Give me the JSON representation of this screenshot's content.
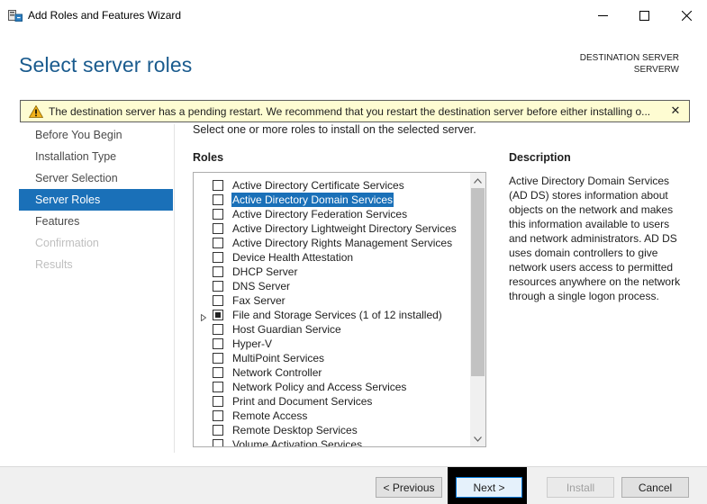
{
  "window": {
    "title": "Add Roles and Features Wizard",
    "minimize_icon": "minimize-icon",
    "maximize_icon": "maximize-icon",
    "close_icon": "close-icon"
  },
  "header": {
    "page_title": "Select server roles",
    "destination_label": "DESTINATION SERVER",
    "destination_value": "SERVERW"
  },
  "warning": {
    "text": "The destination server has a pending restart. We recommend that you restart the destination server before either installing o...",
    "icon": "warning-icon",
    "close_glyph": "✕"
  },
  "nav": {
    "items": [
      {
        "label": "Before You Begin",
        "state": "normal"
      },
      {
        "label": "Installation Type",
        "state": "normal"
      },
      {
        "label": "Server Selection",
        "state": "normal"
      },
      {
        "label": "Server Roles",
        "state": "active"
      },
      {
        "label": "Features",
        "state": "normal"
      },
      {
        "label": "Confirmation",
        "state": "disabled"
      },
      {
        "label": "Results",
        "state": "disabled"
      }
    ]
  },
  "main": {
    "instruction": "Select one or more roles to install on the selected server.",
    "roles_heading": "Roles",
    "description_heading": "Description",
    "description_text": "Active Directory Domain Services (AD DS) stores information about objects on the network and makes this information available to users and network administrators. AD DS uses domain controllers to give network users access to permitted resources anywhere on the network through a single logon process.",
    "roles": [
      {
        "label": "Active Directory Certificate Services",
        "checked": false
      },
      {
        "label": "Active Directory Domain Services",
        "checked": false,
        "selected": true
      },
      {
        "label": "Active Directory Federation Services",
        "checked": false
      },
      {
        "label": "Active Directory Lightweight Directory Services",
        "checked": false
      },
      {
        "label": "Active Directory Rights Management Services",
        "checked": false
      },
      {
        "label": "Device Health Attestation",
        "checked": false
      },
      {
        "label": "DHCP Server",
        "checked": false
      },
      {
        "label": "DNS Server",
        "checked": false
      },
      {
        "label": "Fax Server",
        "checked": false
      },
      {
        "label": "File and Storage Services (1 of 12 installed)",
        "checked": "partial",
        "expandable": true
      },
      {
        "label": "Host Guardian Service",
        "checked": false
      },
      {
        "label": "Hyper-V",
        "checked": false
      },
      {
        "label": "MultiPoint Services",
        "checked": false
      },
      {
        "label": "Network Controller",
        "checked": false
      },
      {
        "label": "Network Policy and Access Services",
        "checked": false
      },
      {
        "label": "Print and Document Services",
        "checked": false
      },
      {
        "label": "Remote Access",
        "checked": false
      },
      {
        "label": "Remote Desktop Services",
        "checked": false
      },
      {
        "label": "Volume Activation Services",
        "checked": false
      }
    ]
  },
  "buttons": {
    "previous": "< Previous",
    "next": "Next >",
    "install": "Install",
    "cancel": "Cancel"
  },
  "colors": {
    "accent": "#1a70b8",
    "title": "#1a5b8e",
    "warning_bg": "#fefcd2"
  }
}
